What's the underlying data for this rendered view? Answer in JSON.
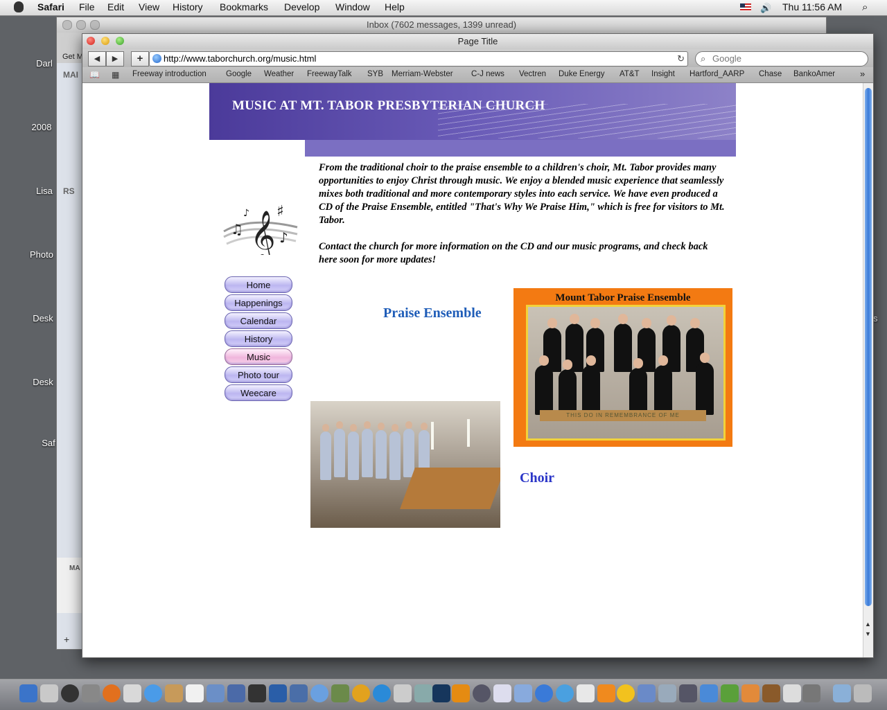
{
  "menubar": {
    "app": "Safari",
    "menus": [
      "File",
      "Edit",
      "View",
      "History",
      "Bookmarks",
      "Develop",
      "Window",
      "Help"
    ],
    "clock": "Thu 11:56 AM"
  },
  "desktop": {
    "labels": [
      "Darl",
      "2008",
      "Lisa",
      "Photo",
      "Desk",
      "Desk",
      "Saf"
    ],
    "right_label": "s"
  },
  "mail": {
    "title": "Inbox (7602 messages, 1399 unread)",
    "get_mail": "Get M",
    "section_mail": "MAI",
    "section_rss": "RS",
    "bottom_section": "MA",
    "add": "+"
  },
  "safari": {
    "title": "Page Title",
    "back": "◀",
    "forward": "▶",
    "add": "+",
    "url": "http://www.taborchurch.org/music.html",
    "search_placeholder": "Google",
    "bookmarks": [
      "Freeway introduction",
      "Google",
      "Weather",
      "FreewayTalk",
      "SYB",
      "Merriam-Webster",
      "C-J news",
      "Vectren",
      "Duke Energy",
      "AT&T",
      "Insight",
      "Hartford_AARP",
      "Chase",
      "BankoAmer"
    ],
    "more": "»"
  },
  "page": {
    "banner_title": "MUSIC AT MT. TABOR PRESBYTERIAN CHURCH",
    "intro_p1": "From the traditional choir to the praise ensemble to a children's choir, Mt. Tabor provides many opportunities to enjoy Christ through music.  We enjoy a blended music experience that seamlessly mixes both traditional and more contemporary styles into each service.  We have even produced a CD of the  Praise Ensemble, entitled \"That's Why We Praise Him,\" which is free for visitors to Mt. Tabor.",
    "intro_p2": "Contact the church for more information on the CD and our music programs, and check back here soon for more updates!",
    "nav": [
      "Home",
      "Happenings",
      "Calendar",
      "History",
      "Music",
      "Photo tour",
      "Weecare"
    ],
    "active_nav": "Music",
    "praise_label": "Praise Ensemble",
    "choir_label": "Choir",
    "ensemble_caption": "Mount Tabor Praise Ensemble",
    "ensemble_table_text": "THIS DO IN REMEMBRANCE OF ME"
  },
  "colors": {
    "banner": "#5a4aa8",
    "link_blue": "#1f5db8",
    "choir_blue": "#2b36c8",
    "photo_frame": "#f37a12"
  }
}
